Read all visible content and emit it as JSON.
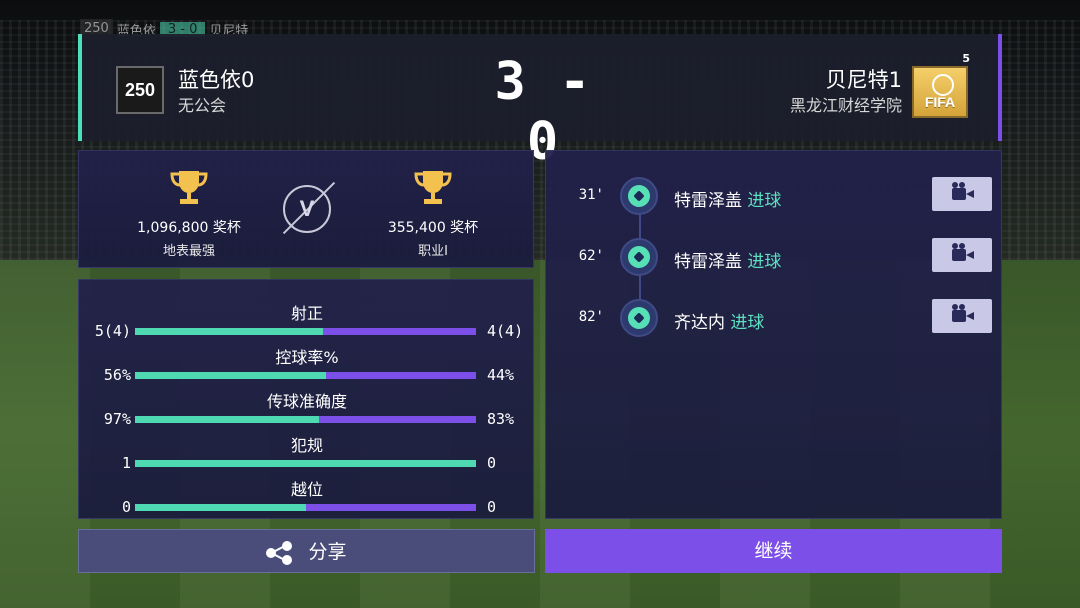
{
  "mini_scoreboard": {
    "home_rating": "250",
    "home_name": "蓝色依",
    "score": "3 - 0",
    "away_name": "贝尼特"
  },
  "header": {
    "home": {
      "rating": "250",
      "name": "蓝色依0",
      "club": "无公会"
    },
    "score": "3 - 0",
    "away": {
      "name": "贝尼特1",
      "club": "黑龙江财经学院",
      "badge_level": "5",
      "badge_text": "FIFA"
    }
  },
  "trophies": {
    "home": {
      "value": "1,096,800 奖杯",
      "division": "地表最强"
    },
    "vs_label": "V",
    "away": {
      "value": "355,400 奖杯",
      "division": "职业I"
    }
  },
  "stats": [
    {
      "label": "射正",
      "home": "5(4)",
      "away": "4(4)",
      "home_share": 0.55
    },
    {
      "label": "控球率%",
      "home": "56%",
      "away": "44%",
      "home_share": 0.56
    },
    {
      "label": "传球准确度",
      "home": "97%",
      "away": "83%",
      "home_share": 0.54
    },
    {
      "label": "犯规",
      "home": "1",
      "away": "0",
      "home_share": 1.0
    },
    {
      "label": "越位",
      "home": "0",
      "away": "0",
      "home_share": 0.5
    }
  ],
  "events": [
    {
      "minute": "31'",
      "player": "特雷泽盖",
      "type": "进球"
    },
    {
      "minute": "62'",
      "player": "特雷泽盖",
      "type": "进球"
    },
    {
      "minute": "82'",
      "player": "齐达内",
      "type": "进球"
    }
  ],
  "buttons": {
    "share": "分享",
    "continue": "继续"
  },
  "colors": {
    "home_accent": "#4fd9b2",
    "away_accent": "#7b4fe8",
    "panel_bg": "#22204a"
  }
}
